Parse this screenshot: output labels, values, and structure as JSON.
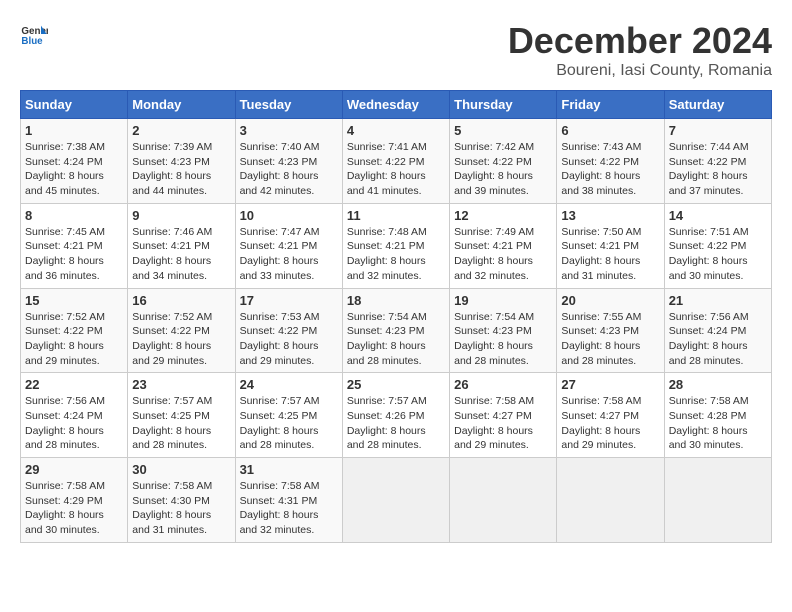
{
  "header": {
    "logo_general": "General",
    "logo_blue": "Blue",
    "title": "December 2024",
    "subtitle": "Boureni, Iasi County, Romania"
  },
  "days_of_week": [
    "Sunday",
    "Monday",
    "Tuesday",
    "Wednesday",
    "Thursday",
    "Friday",
    "Saturday"
  ],
  "weeks": [
    [
      {
        "day": "1",
        "rise": "7:38 AM",
        "set": "4:24 PM",
        "daylight": "8 hours and 45 minutes."
      },
      {
        "day": "2",
        "rise": "7:39 AM",
        "set": "4:23 PM",
        "daylight": "8 hours and 44 minutes."
      },
      {
        "day": "3",
        "rise": "7:40 AM",
        "set": "4:23 PM",
        "daylight": "8 hours and 42 minutes."
      },
      {
        "day": "4",
        "rise": "7:41 AM",
        "set": "4:22 PM",
        "daylight": "8 hours and 41 minutes."
      },
      {
        "day": "5",
        "rise": "7:42 AM",
        "set": "4:22 PM",
        "daylight": "8 hours and 39 minutes."
      },
      {
        "day": "6",
        "rise": "7:43 AM",
        "set": "4:22 PM",
        "daylight": "8 hours and 38 minutes."
      },
      {
        "day": "7",
        "rise": "7:44 AM",
        "set": "4:22 PM",
        "daylight": "8 hours and 37 minutes."
      }
    ],
    [
      {
        "day": "8",
        "rise": "7:45 AM",
        "set": "4:21 PM",
        "daylight": "8 hours and 36 minutes."
      },
      {
        "day": "9",
        "rise": "7:46 AM",
        "set": "4:21 PM",
        "daylight": "8 hours and 34 minutes."
      },
      {
        "day": "10",
        "rise": "7:47 AM",
        "set": "4:21 PM",
        "daylight": "8 hours and 33 minutes."
      },
      {
        "day": "11",
        "rise": "7:48 AM",
        "set": "4:21 PM",
        "daylight": "8 hours and 32 minutes."
      },
      {
        "day": "12",
        "rise": "7:49 AM",
        "set": "4:21 PM",
        "daylight": "8 hours and 32 minutes."
      },
      {
        "day": "13",
        "rise": "7:50 AM",
        "set": "4:21 PM",
        "daylight": "8 hours and 31 minutes."
      },
      {
        "day": "14",
        "rise": "7:51 AM",
        "set": "4:22 PM",
        "daylight": "8 hours and 30 minutes."
      }
    ],
    [
      {
        "day": "15",
        "rise": "7:52 AM",
        "set": "4:22 PM",
        "daylight": "8 hours and 29 minutes."
      },
      {
        "day": "16",
        "rise": "7:52 AM",
        "set": "4:22 PM",
        "daylight": "8 hours and 29 minutes."
      },
      {
        "day": "17",
        "rise": "7:53 AM",
        "set": "4:22 PM",
        "daylight": "8 hours and 29 minutes."
      },
      {
        "day": "18",
        "rise": "7:54 AM",
        "set": "4:23 PM",
        "daylight": "8 hours and 28 minutes."
      },
      {
        "day": "19",
        "rise": "7:54 AM",
        "set": "4:23 PM",
        "daylight": "8 hours and 28 minutes."
      },
      {
        "day": "20",
        "rise": "7:55 AM",
        "set": "4:23 PM",
        "daylight": "8 hours and 28 minutes."
      },
      {
        "day": "21",
        "rise": "7:56 AM",
        "set": "4:24 PM",
        "daylight": "8 hours and 28 minutes."
      }
    ],
    [
      {
        "day": "22",
        "rise": "7:56 AM",
        "set": "4:24 PM",
        "daylight": "8 hours and 28 minutes."
      },
      {
        "day": "23",
        "rise": "7:57 AM",
        "set": "4:25 PM",
        "daylight": "8 hours and 28 minutes."
      },
      {
        "day": "24",
        "rise": "7:57 AM",
        "set": "4:25 PM",
        "daylight": "8 hours and 28 minutes."
      },
      {
        "day": "25",
        "rise": "7:57 AM",
        "set": "4:26 PM",
        "daylight": "8 hours and 28 minutes."
      },
      {
        "day": "26",
        "rise": "7:58 AM",
        "set": "4:27 PM",
        "daylight": "8 hours and 29 minutes."
      },
      {
        "day": "27",
        "rise": "7:58 AM",
        "set": "4:27 PM",
        "daylight": "8 hours and 29 minutes."
      },
      {
        "day": "28",
        "rise": "7:58 AM",
        "set": "4:28 PM",
        "daylight": "8 hours and 30 minutes."
      }
    ],
    [
      {
        "day": "29",
        "rise": "7:58 AM",
        "set": "4:29 PM",
        "daylight": "8 hours and 30 minutes."
      },
      {
        "day": "30",
        "rise": "7:58 AM",
        "set": "4:30 PM",
        "daylight": "8 hours and 31 minutes."
      },
      {
        "day": "31",
        "rise": "7:58 AM",
        "set": "4:31 PM",
        "daylight": "8 hours and 32 minutes."
      },
      null,
      null,
      null,
      null
    ]
  ]
}
